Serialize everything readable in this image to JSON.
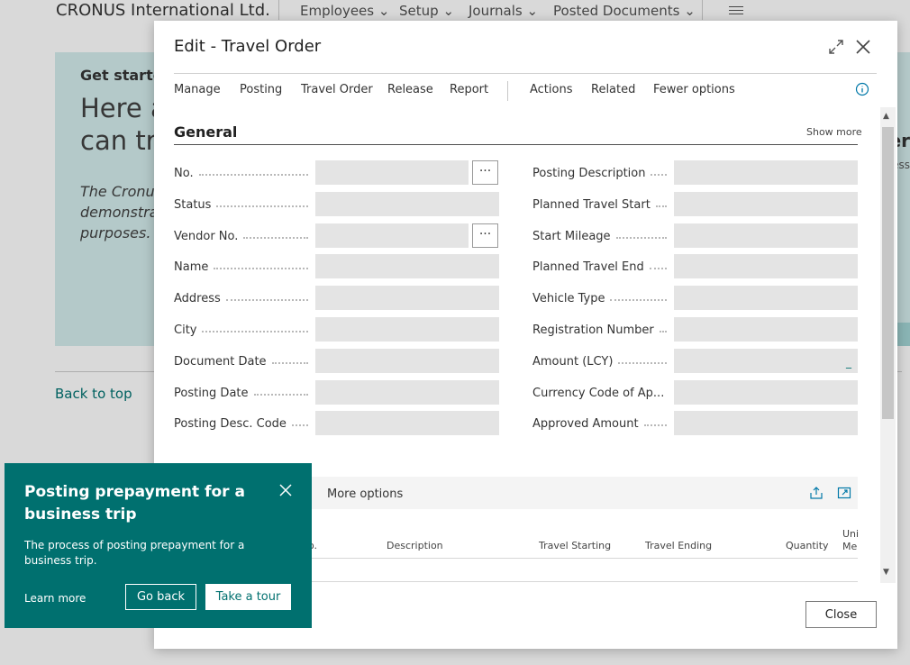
{
  "background": {
    "company": "CRONUS International Ltd.",
    "nav": [
      "Employees",
      "Setup",
      "Journals",
      "Posted Documents"
    ],
    "card_title": "Get started",
    "card_big_line1": "Here a",
    "card_big_line2": "can try",
    "card_italic_line1": "The Cronus",
    "card_italic_line2": "demonstrat",
    "card_italic_line3": "purposes.",
    "card_right": "er",
    "card_right2": "ess",
    "back_to_top": "Back to top"
  },
  "dialog": {
    "title": "Edit - Travel Order",
    "actions": [
      "Manage",
      "Posting",
      "Travel Order",
      "Release",
      "Report",
      "Actions",
      "Related",
      "Fewer options"
    ],
    "section_title": "General",
    "show_more": "Show more",
    "left_fields": [
      {
        "label": "No.",
        "value": ""
      },
      {
        "label": "Status",
        "value": ""
      },
      {
        "label": "Vendor No.",
        "value": ""
      },
      {
        "label": "Name",
        "value": ""
      },
      {
        "label": "Address",
        "value": ""
      },
      {
        "label": "City",
        "value": ""
      },
      {
        "label": "Document Date",
        "value": ""
      },
      {
        "label": "Posting Date",
        "value": ""
      },
      {
        "label": "Posting Desc. Code",
        "value": ""
      }
    ],
    "right_fields": [
      {
        "label": "Posting Description",
        "value": ""
      },
      {
        "label": "Planned Travel Start",
        "value": ""
      },
      {
        "label": "Start Mileage",
        "value": ""
      },
      {
        "label": "Planned Travel End",
        "value": ""
      },
      {
        "label": "Vehicle Type",
        "value": ""
      },
      {
        "label": "Registration Number",
        "value": ""
      },
      {
        "label": "Amount (LCY)",
        "value": "_"
      },
      {
        "label": "Currency Code of Ap...",
        "value": ""
      },
      {
        "label": "Approved Amount",
        "value": ""
      }
    ],
    "lookup_label": "···",
    "lines": {
      "more_options": "More options",
      "headers": [
        "o.",
        "Description",
        "Travel Starting",
        "Travel Ending",
        "Quantity",
        "Uni",
        "Me"
      ]
    },
    "close_label": "Close"
  },
  "tip": {
    "title": "Posting prepayment for a business trip",
    "body": "The process of posting prepayment for a business trip.",
    "learn_more": "Learn more",
    "go_back": "Go back",
    "take_tour": "Take a tour"
  }
}
